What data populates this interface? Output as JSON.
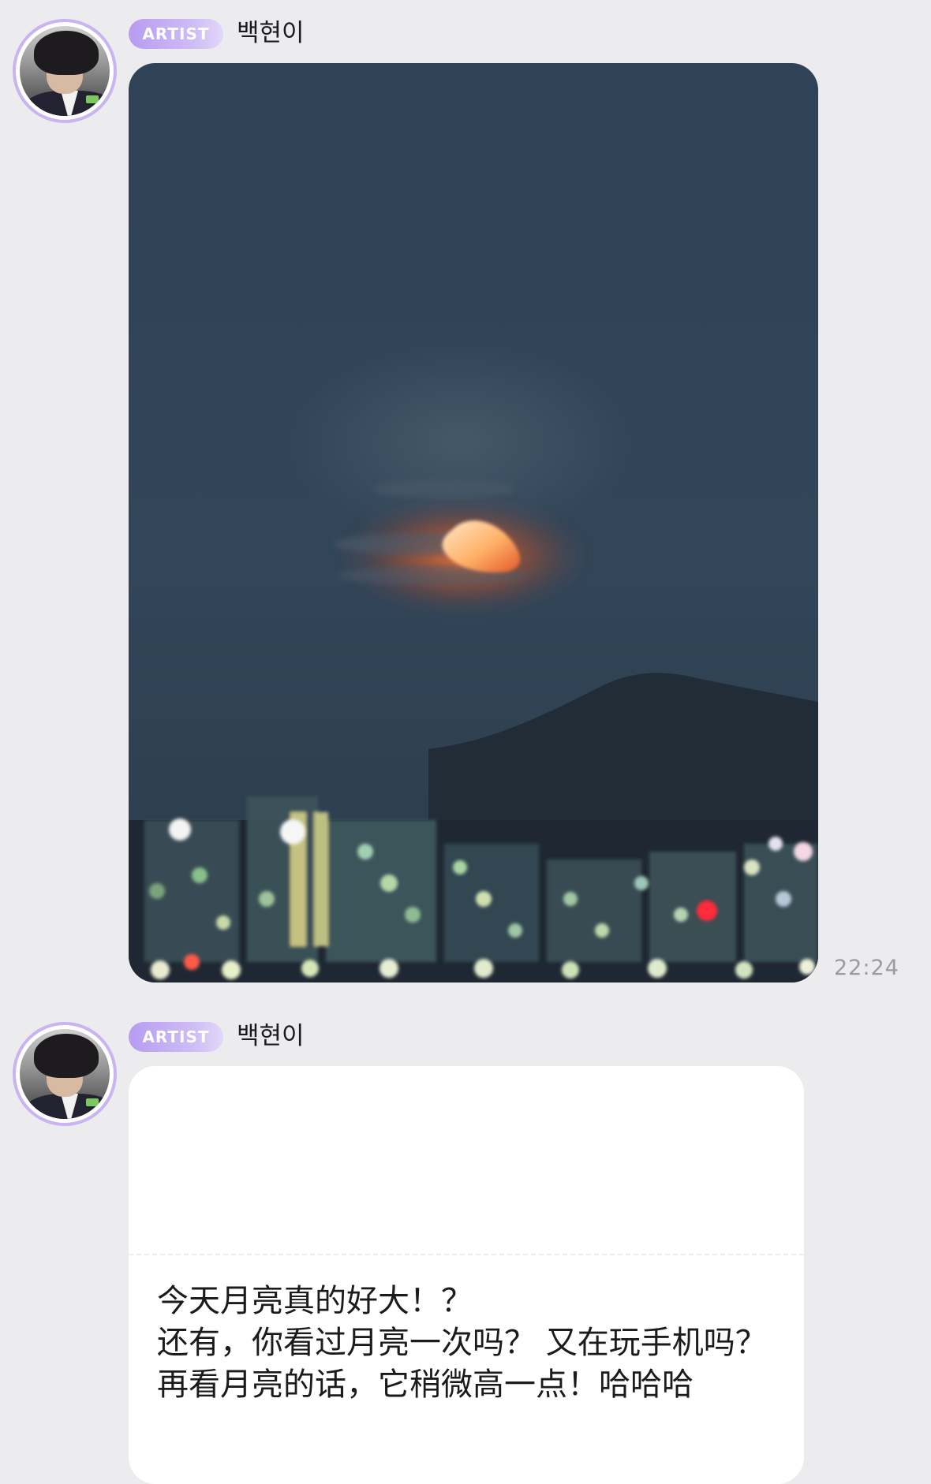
{
  "messages": [
    {
      "badge": "ARTIST",
      "sender": "백현이",
      "type": "image",
      "image_description": "night sky with orange half moon over blurred city lights and mountain",
      "time": "22:24"
    },
    {
      "badge": "ARTIST",
      "sender": "백현이",
      "type": "text",
      "text": "今天月亮真的好大！？\n还有，你看过月亮一次吗？ 又在玩手机吗？ 再看月亮的话，它稍微高一点！哈哈哈"
    }
  ],
  "colors": {
    "background": "#ececee",
    "artist_badge": "#b79cf1",
    "avatar_ring": "#c9b3f0",
    "timestamp": "#9a9aa1"
  },
  "icons": [
    "avatar"
  ]
}
